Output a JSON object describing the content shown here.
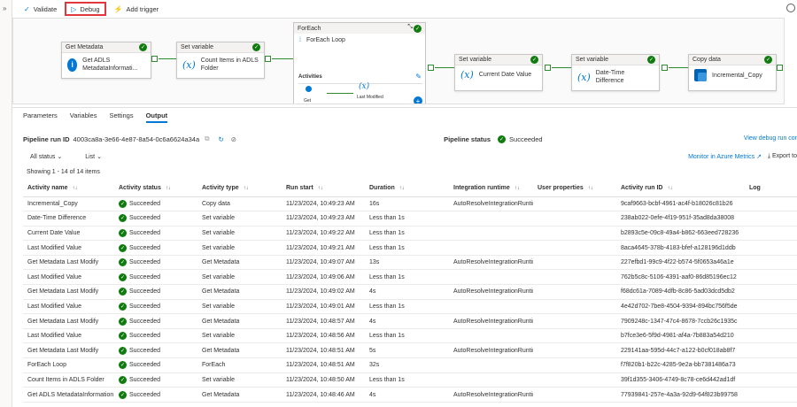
{
  "toolbar": {
    "validate": "Validate",
    "debug": "Debug",
    "add_trigger": "Add trigger"
  },
  "canvas": {
    "activities": [
      {
        "type": "Get Metadata",
        "name": "Get ADLS MetadataInformati..."
      },
      {
        "type": "Set variable",
        "name": "Count Items in ADLS Folder"
      },
      {
        "type": "Set variable",
        "name": "Current Date Value"
      },
      {
        "type": "Set variable",
        "name": "Date-Time Difference"
      },
      {
        "type": "Copy data",
        "name": "Incremental_Copy"
      }
    ],
    "foreach": {
      "type": "ForEach",
      "name": "ForEach Loop",
      "activities_label": "Activities",
      "inner_first": "Get",
      "inner_second": "Last Modified"
    }
  },
  "tabs": [
    "Parameters",
    "Variables",
    "Settings",
    "Output"
  ],
  "run": {
    "id_label": "Pipeline run ID",
    "id_value": "4003ca8a-3e66-4e87-8a54-0c6a6624a34a",
    "status_label": "Pipeline status",
    "status_value": "Succeeded",
    "view_debug": "View debug run cor"
  },
  "filters": {
    "status": "All status",
    "view": "List"
  },
  "monitor_link": "Monitor in Azure Metrics",
  "export": "Export to",
  "showing": "Showing 1 - 14 of 14 items",
  "columns": [
    "Activity name",
    "Activity status",
    "Activity type",
    "Run start",
    "Duration",
    "Integration runtime",
    "User properties",
    "Activity run ID",
    "Log"
  ],
  "rows": [
    {
      "name": "Incremental_Copy",
      "status": "Succeeded",
      "type": "Copy data",
      "start": "11/23/2024, 10:49:23 AM",
      "duration": "16s",
      "runtime": "AutoResolveIntegrationRuntin",
      "id": "9caf9663-bcbf-4961-ac4f-b18026c81b26"
    },
    {
      "name": "Date-Time Difference",
      "status": "Succeeded",
      "type": "Set variable",
      "start": "11/23/2024, 10:49:23 AM",
      "duration": "Less than 1s",
      "runtime": "",
      "id": "238ab022-0efe-4f19-951f-35ad8da38008"
    },
    {
      "name": "Current Date Value",
      "status": "Succeeded",
      "type": "Set variable",
      "start": "11/23/2024, 10:49:22 AM",
      "duration": "Less than 1s",
      "runtime": "",
      "id": "b2893c5e-09c8-49a4-b862-663eed728236"
    },
    {
      "name": "Last Modified Value",
      "status": "Succeeded",
      "type": "Set variable",
      "start": "11/23/2024, 10:49:21 AM",
      "duration": "Less than 1s",
      "runtime": "",
      "id": "8aca4645-378b-4183-bfef-a128196d1ddb"
    },
    {
      "name": "Get Metadata Last Modify",
      "status": "Succeeded",
      "type": "Get Metadata",
      "start": "11/23/2024, 10:49:07 AM",
      "duration": "13s",
      "runtime": "AutoResolveIntegrationRuntin",
      "id": "227efbd1-99c9-4f22-b574-5f0653a46a1e"
    },
    {
      "name": "Last Modified Value",
      "status": "Succeeded",
      "type": "Set variable",
      "start": "11/23/2024, 10:49:06 AM",
      "duration": "Less than 1s",
      "runtime": "",
      "id": "762b5c8c-5106-4391-aaf0-86d85196ec12"
    },
    {
      "name": "Get Metadata Last Modify",
      "status": "Succeeded",
      "type": "Get Metadata",
      "start": "11/23/2024, 10:49:02 AM",
      "duration": "4s",
      "runtime": "AutoResolveIntegrationRuntin",
      "id": "f68dc61a-7089-4dfb-8c86-5ad03dcd5db2"
    },
    {
      "name": "Last Modified Value",
      "status": "Succeeded",
      "type": "Set variable",
      "start": "11/23/2024, 10:49:01 AM",
      "duration": "Less than 1s",
      "runtime": "",
      "id": "4e42d702-7be8-4504-9394-894bc756f5de"
    },
    {
      "name": "Get Metadata Last Modify",
      "status": "Succeeded",
      "type": "Get Metadata",
      "start": "11/23/2024, 10:48:57 AM",
      "duration": "4s",
      "runtime": "AutoResolveIntegrationRuntin",
      "id": "7909248c-1347-47c4-8678-7ccb26c1935c"
    },
    {
      "name": "Last Modified Value",
      "status": "Succeeded",
      "type": "Set variable",
      "start": "11/23/2024, 10:48:56 AM",
      "duration": "Less than 1s",
      "runtime": "",
      "id": "b7fce3e6-5f9d-4981-af4a-7b883a54d210"
    },
    {
      "name": "Get Metadata Last Modify",
      "status": "Succeeded",
      "type": "Get Metadata",
      "start": "11/23/2024, 10:48:51 AM",
      "duration": "5s",
      "runtime": "AutoResolveIntegrationRuntin",
      "id": "229141aa-595d-44c7-a122-b0cf018ab8f7"
    },
    {
      "name": "ForEach Loop",
      "status": "Succeeded",
      "type": "ForEach",
      "start": "11/23/2024, 10:48:51 AM",
      "duration": "32s",
      "runtime": "",
      "id": "f7f820b1-b22c-4285-9e2a-bb7381486a73"
    },
    {
      "name": "Count Items in ADLS Folder",
      "status": "Succeeded",
      "type": "Set variable",
      "start": "11/23/2024, 10:48:50 AM",
      "duration": "Less than 1s",
      "runtime": "",
      "id": "39f1d355-3406-4749-8c78-ce6d442ad1df"
    },
    {
      "name": "Get ADLS MetadataInformation",
      "status": "Succeeded",
      "type": "Get Metadata",
      "start": "11/23/2024, 10:48:46 AM",
      "duration": "4s",
      "runtime": "AutoResolveIntegrationRuntin",
      "id": "77939841-257e-4a3a-92d9-64f823b99758"
    }
  ]
}
